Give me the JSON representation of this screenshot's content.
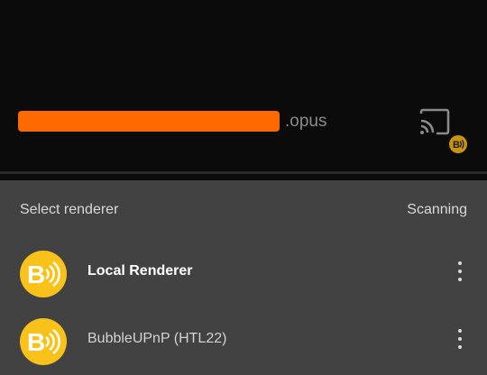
{
  "player": {
    "file_extension": ".opus",
    "cast_icon": "cast-icon",
    "badge_icon": "bubbleupnp-badge-icon"
  },
  "renderer_sheet": {
    "title": "Select renderer",
    "status": "Scanning",
    "items": [
      {
        "label": "Local Renderer",
        "selected": true,
        "icon": "bubbleupnp-logo-icon"
      },
      {
        "label": "BubbleUPnP (HTL22)",
        "selected": false,
        "icon": "bubbleupnp-logo-icon"
      }
    ]
  },
  "colors": {
    "accent": "#f9c21a",
    "redaction": "#ff6a00",
    "sheet_background": "#424242"
  }
}
